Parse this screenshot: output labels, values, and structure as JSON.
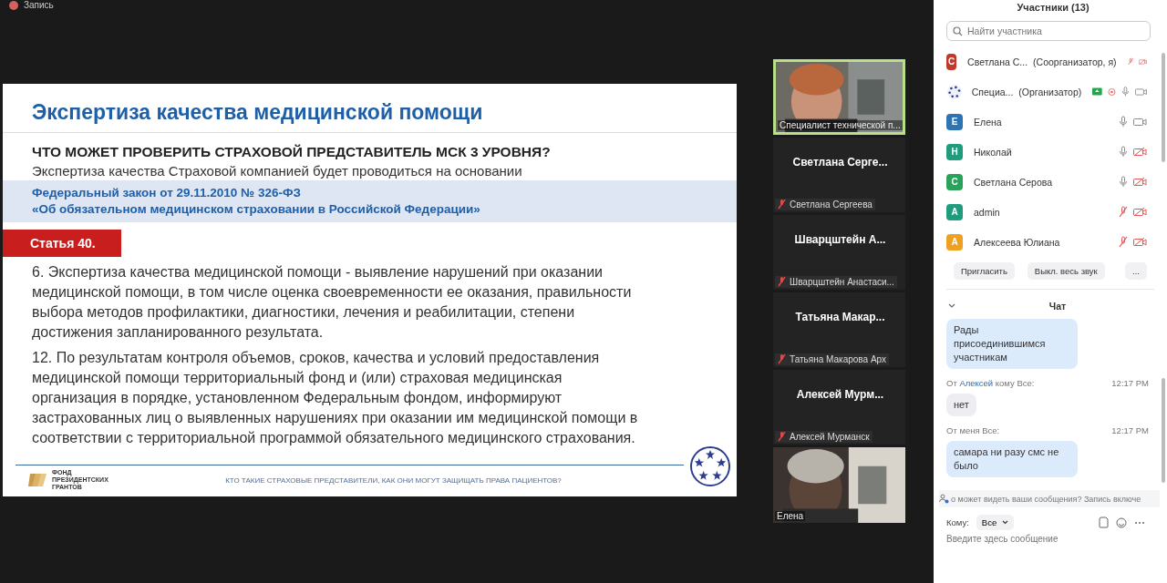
{
  "recording": {
    "label": "Запись"
  },
  "slide": {
    "title": "Экспертиза качества медицинской помощи",
    "heading": "ЧТО МОЖЕТ ПРОВЕРИТЬ СТРАХОВОЙ ПРЕДСТАВИТЕЛЬ МСК 3 УРОВНЯ?",
    "subheading": "Экспертиза качества Страховой компанией будет проводиться на основании",
    "law_lines": [
      "Федеральный закон от 29.11.2010 № 326-ФЗ",
      "«Об обязательном медицинском страховании в Российской Федерации»"
    ],
    "article": "Статья 40.",
    "paragraphs": [
      "6. Экспертиза качества медицинской помощи - выявление нарушений при оказании медицинской помощи, в том числе оценка своевременности ее оказания, правильности выбора методов профилактики, диагностики, лечения и реабилитации, степени достижения запланированного результата.",
      "12. По результатам контроля объемов, сроков, качества и условий предоставления медицинской помощи территориальный фонд и (или) страховая медицинская организация в порядке, установленном Федеральным фондом, информируют застрахованных лиц о выявленных нарушениях при оказании им медицинской помощи в соответствии с территориальной программой обязательного медицинского страхования."
    ],
    "footer_logo_text": "ФОНД ПРЕЗИДЕНТСКИХ ГРАНТОВ",
    "footer_caption": "КТО ТАКИЕ СТРАХОВЫЕ ПРЕДСТАВИТЕЛИ, КАК ОНИ МОГУТ ЗАЩИЩАТЬ ПРАВА ПАЦИЕНТОВ?"
  },
  "video_tiles": [
    {
      "kind": "video",
      "name": "Специалист технической п...",
      "selected": true
    },
    {
      "kind": "name",
      "display_name": "Светлана Серге...",
      "name": "Светлана Сергеева",
      "muted": true,
      "selected": false
    },
    {
      "kind": "name",
      "display_name": "Шварцштейн А...",
      "name": "Шварцштейн Анастаси...",
      "muted": true,
      "selected": false
    },
    {
      "kind": "name",
      "display_name": "Татьяна Макар...",
      "name": "Татьяна Макарова Арх",
      "muted": true,
      "selected": false
    },
    {
      "kind": "name",
      "display_name": "Алексей Мурм...",
      "name": "Алексей Мурманск",
      "muted": true,
      "selected": false
    },
    {
      "kind": "video",
      "name": "Елена",
      "selected": false
    }
  ],
  "participants": {
    "title": "Участники (13)",
    "search_placeholder": "Найти участника",
    "items": [
      {
        "kind": "letter",
        "letter": "С",
        "color": "#c0392b",
        "name": "Светлана С...",
        "role": "(Соорганизатор, я)",
        "sharing": false,
        "recording": false,
        "muted": true,
        "video_on": false
      },
      {
        "kind": "logo",
        "name": "Специа...",
        "role": "(Организатор)",
        "sharing": true,
        "recording": true,
        "muted": false,
        "video_on": true
      },
      {
        "kind": "letter",
        "letter": "Е",
        "color": "#2e74b5",
        "name": "Елена",
        "sharing": false,
        "recording": false,
        "muted": false,
        "video_on": true
      },
      {
        "kind": "letter",
        "letter": "Н",
        "color": "#1e9c7c",
        "name": "Николай",
        "sharing": false,
        "recording": false,
        "muted": false,
        "video_on": false
      },
      {
        "kind": "letter",
        "letter": "С",
        "color": "#2aa35a",
        "name": "Светлана Серова",
        "sharing": false,
        "recording": false,
        "muted": false,
        "video_on": false
      },
      {
        "kind": "letter",
        "letter": "A",
        "color": "#1e9c7c",
        "name": "admin",
        "sharing": false,
        "recording": false,
        "muted": true,
        "video_on": false
      },
      {
        "kind": "letter",
        "letter": "А",
        "color": "#f0a020",
        "name": "Алексеева Юлиана",
        "sharing": false,
        "recording": false,
        "muted": true,
        "video_on": false
      }
    ],
    "buttons": [
      "Пригласить",
      "Выкл. весь звук",
      "..."
    ]
  },
  "chat": {
    "title": "Чат",
    "messages": [
      {
        "kind": "bubble",
        "text": "Рады присоединившимся участникам",
        "mine": true
      },
      {
        "kind": "meta",
        "from": "От",
        "sender": "Алексей",
        "to": "кому Все:",
        "time": "12:17 PM"
      },
      {
        "kind": "bubble",
        "text": "нет",
        "mine": false
      },
      {
        "kind": "meta",
        "from": "От меня Все:",
        "time": "12:17 PM"
      },
      {
        "kind": "bubble",
        "text": "самара ни разу смс не было",
        "mine": true
      }
    ],
    "notice": "о может видеть ваши сообщения? Запись включе",
    "to_label": "Кому:",
    "to_value": "Все",
    "placeholder": "Введите здесь сообщение"
  }
}
